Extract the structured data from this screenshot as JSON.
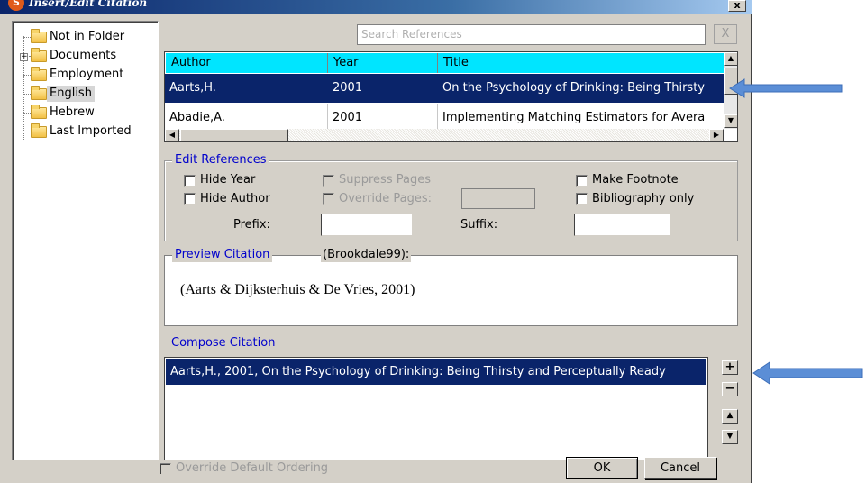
{
  "window": {
    "title": "Insert/Edit Citation",
    "close_label": "x",
    "icon_glyph": "S"
  },
  "folders": {
    "items": [
      {
        "label": "Not in Folder",
        "selected": false
      },
      {
        "label": "Documents",
        "selected": false,
        "expander": "+"
      },
      {
        "label": "Employment",
        "selected": false
      },
      {
        "label": "English",
        "selected": true
      },
      {
        "label": "Hebrew",
        "selected": false
      },
      {
        "label": "Last Imported",
        "selected": false
      }
    ]
  },
  "search": {
    "placeholder": "Search References",
    "clear_label": "X"
  },
  "references": {
    "columns": [
      "Author",
      "Year",
      "Title"
    ],
    "rows": [
      {
        "author": "Aarts,H.",
        "year": "2001",
        "title": "On the Psychology of Drinking: Being Thirsty",
        "selected": true
      },
      {
        "author": "Abadie,A.",
        "year": "2001",
        "title": "Implementing Matching Estimators for Avera",
        "selected": false
      }
    ]
  },
  "edit_refs": {
    "legend": "Edit References",
    "hide_year": "Hide Year",
    "hide_author": "Hide Author",
    "suppress_pages": "Suppress Pages",
    "override_pages": "Override Pages:",
    "make_footnote": "Make Footnote",
    "bibliography_only": "Bibliography only",
    "prefix_label": "Prefix:",
    "suffix_label": "Suffix:",
    "prefix_value": "",
    "suffix_value": "",
    "override_pages_value": ""
  },
  "preview": {
    "legend": "Preview Citation",
    "style": "(Brookdale99):",
    "text": "(Aarts & Dijksterhuis & De Vries, 2001)"
  },
  "compose": {
    "legend": "Compose Citation",
    "items": [
      "Aarts,H., 2001, On the Psychology of Drinking: Being Thirsty and Perceptually Ready"
    ],
    "add_label": "+",
    "remove_label": "−",
    "up_label": "▲",
    "down_label": "▼"
  },
  "footer": {
    "override_ordering": "Override Default Ordering",
    "ok": "OK",
    "cancel": "Cancel"
  },
  "colors": {
    "header_cyan": "#00e5ff",
    "selection_navy": "#0a246a",
    "legend_blue": "#0000cc",
    "arrow_blue": "#5b8ed6"
  }
}
